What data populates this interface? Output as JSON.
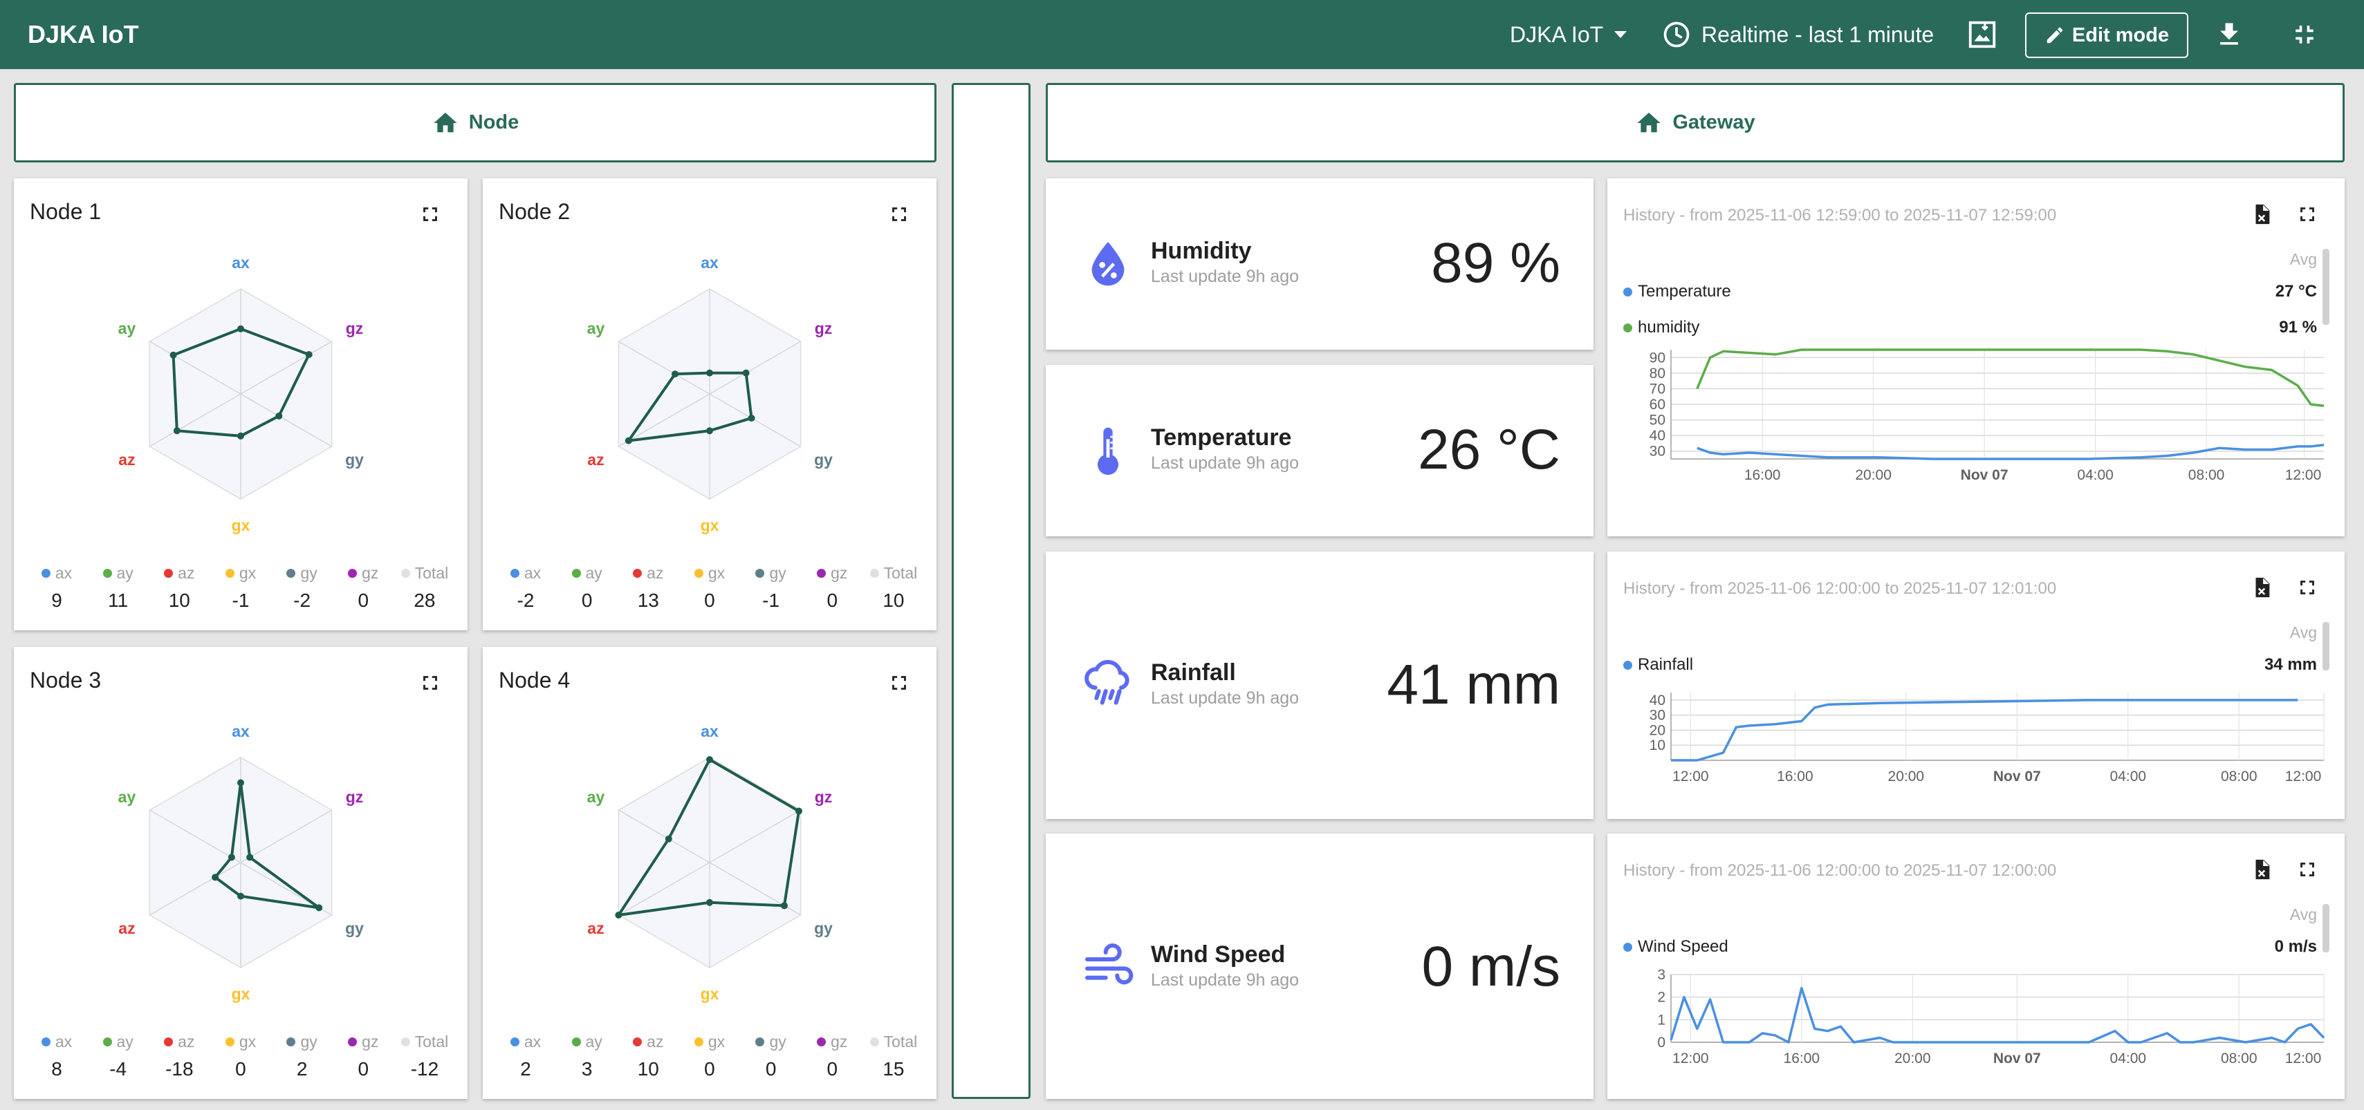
{
  "app": {
    "title": "DJKA IoT"
  },
  "toolbar": {
    "dashboard": "DJKA IoT",
    "time": "Realtime - last 1 minute",
    "edit_label": "Edit mode"
  },
  "nav": {
    "node": "Node",
    "gateway": "Gateway"
  },
  "colors": {
    "brand": "#2a6a5a",
    "ax": "#4a90e2",
    "ay": "#5cad4a",
    "az": "#e53935",
    "gx": "#fbc02d",
    "gy": "#607d8b",
    "gz": "#9c27b0",
    "total": "#e0e0e0",
    "radar_line": "#1f5c4b",
    "value_icon": "#5c6bf0"
  },
  "legend_labels": [
    "ax",
    "ay",
    "az",
    "gx",
    "gy",
    "gz",
    "Total"
  ],
  "nodes": [
    {
      "title": "Node 1",
      "values": [
        "9",
        "11",
        "10",
        "-1",
        "-2",
        "0",
        "28"
      ]
    },
    {
      "title": "Node 2",
      "values": [
        "-2",
        "0",
        "13",
        "0",
        "-1",
        "0",
        "10"
      ]
    },
    {
      "title": "Node 3",
      "values": [
        "8",
        "-4",
        "-18",
        "0",
        "2",
        "0",
        "-12"
      ]
    },
    {
      "title": "Node 4",
      "values": [
        "2",
        "3",
        "10",
        "0",
        "0",
        "0",
        "15"
      ]
    }
  ],
  "gateway": [
    {
      "name": "Humidity",
      "sub": "Last update 9h ago",
      "value": "89 %",
      "icon": "water-percent-icon"
    },
    {
      "name": "Temperature",
      "sub": "Last update 9h ago",
      "value": "26 °C",
      "icon": "thermometer-icon"
    },
    {
      "name": "Rainfall",
      "sub": "Last update 9h ago",
      "value": "41 mm",
      "icon": "rain-cloud-icon"
    },
    {
      "name": "Wind Speed",
      "sub": "Last update 9h ago",
      "value": "0 m/s",
      "icon": "wind-icon"
    }
  ],
  "history": [
    {
      "title": "History - from 2025-11-06 12:59:00 to 2025-11-07 12:59:00",
      "avg_label": "Avg",
      "legend": [
        {
          "name": "Temperature",
          "value": "27 °C",
          "color": "#4a90e2"
        },
        {
          "name": "humidity",
          "value": "91 %",
          "color": "#5cad4a"
        }
      ]
    },
    {
      "title": "History - from 2025-11-06 12:00:00 to 2025-11-07 12:01:00",
      "avg_label": "Avg",
      "legend": [
        {
          "name": "Rainfall",
          "value": "34 mm",
          "color": "#4a90e2"
        }
      ]
    },
    {
      "title": "History - from 2025-11-06 12:00:00 to 2025-11-07 12:00:00",
      "avg_label": "Avg",
      "legend": [
        {
          "name": "Wind Speed",
          "value": "0 m/s",
          "color": "#4a90e2"
        }
      ]
    }
  ],
  "chart_data": [
    {
      "type": "line",
      "title": "",
      "x_ticks": [
        "16:00",
        "20:00",
        "Nov 07",
        "04:00",
        "08:00",
        "12:00"
      ],
      "x": [
        13.0,
        13.5,
        14.0,
        15.0,
        16.0,
        17.0,
        18.0,
        19.0,
        20.0,
        22.0,
        24.0,
        26.0,
        28.0,
        30.0,
        31.0,
        32.0,
        33.0,
        34.0,
        35.0,
        36.0,
        36.5,
        37.0
      ],
      "ylim": [
        25,
        95
      ],
      "y_ticks": [
        30,
        40,
        50,
        60,
        70,
        80,
        90
      ],
      "series": [
        {
          "name": "Temperature",
          "values": [
            32,
            29,
            28,
            29,
            28,
            27,
            26,
            26,
            26,
            25,
            25,
            25,
            25,
            26,
            27,
            29,
            32,
            31,
            31,
            33,
            33,
            34
          ]
        },
        {
          "name": "humidity",
          "values": [
            70,
            90,
            94,
            93,
            92,
            95,
            95,
            95,
            95,
            95,
            95,
            95,
            95,
            95,
            94,
            92,
            88,
            84,
            82,
            72,
            60,
            59
          ]
        }
      ]
    },
    {
      "type": "line",
      "title": "",
      "x_ticks": [
        "12:00",
        "16:00",
        "20:00",
        "Nov 07",
        "04:00",
        "08:00",
        "12:00"
      ],
      "x": [
        12.0,
        13.0,
        14.0,
        14.5,
        15.0,
        16.0,
        17.0,
        17.5,
        18.0,
        20.0,
        24.0,
        28.0,
        32.0,
        36.0
      ],
      "ylim": [
        0,
        45
      ],
      "y_ticks": [
        10,
        20,
        30,
        40
      ],
      "series": [
        {
          "name": "Rainfall",
          "values": [
            0,
            0,
            5,
            22,
            23,
            24,
            26,
            35,
            37,
            38,
            39,
            40,
            40,
            40
          ]
        }
      ]
    },
    {
      "type": "line",
      "title": "",
      "x_ticks": [
        "12:00",
        "16:00",
        "20:00",
        "Nov 07",
        "04:00",
        "08:00",
        "12:00"
      ],
      "x": [
        12.0,
        12.5,
        13.0,
        13.5,
        14.0,
        15.0,
        15.5,
        16.0,
        16.5,
        17.0,
        17.5,
        18.0,
        18.5,
        19.0,
        20.0,
        20.5,
        21.0,
        22.0,
        28.0,
        29.0,
        29.5,
        30.0,
        31.0,
        31.5,
        32.0,
        33.0,
        34.0,
        35.0,
        35.5,
        36.0,
        36.5,
        37.0
      ],
      "ylim": [
        0,
        3
      ],
      "y_ticks": [
        0,
        1,
        2,
        3
      ],
      "series": [
        {
          "name": "Wind Speed",
          "values": [
            0.1,
            2.0,
            0.6,
            1.9,
            0,
            0,
            0.4,
            0.3,
            0.0,
            2.4,
            0.6,
            0.5,
            0.7,
            0,
            0.2,
            0,
            0,
            0,
            0,
            0.5,
            0,
            0,
            0.4,
            0,
            0,
            0.2,
            0,
            0.2,
            0,
            0.6,
            0.8,
            0.2
          ]
        }
      ]
    }
  ]
}
